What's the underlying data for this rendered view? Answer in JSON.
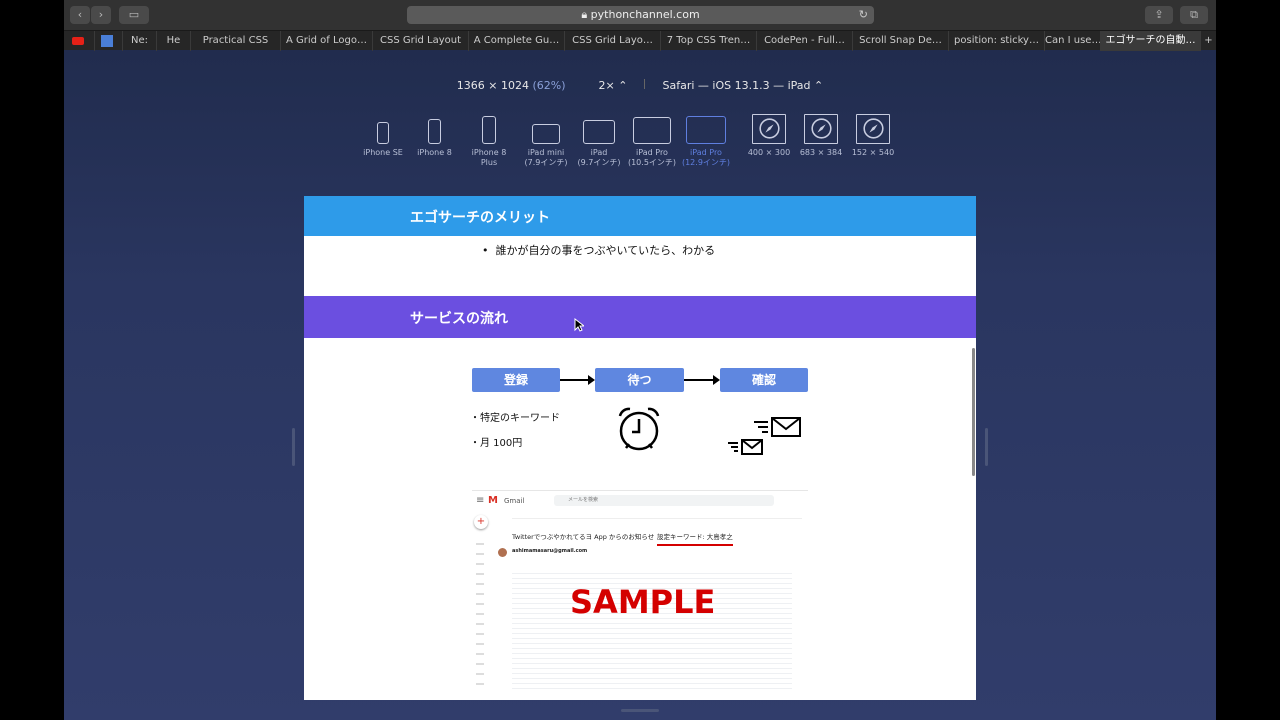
{
  "browser": {
    "url": "pythonchannel.com",
    "tabs": [
      {
        "label": "Ne:"
      },
      {
        "label": "He"
      },
      {
        "label": "Practical CSS"
      },
      {
        "label": "A Grid of Logo…"
      },
      {
        "label": "CSS Grid Layout"
      },
      {
        "label": "A Complete Gu…"
      },
      {
        "label": "CSS Grid Layo…"
      },
      {
        "label": "7 Top CSS Tren…"
      },
      {
        "label": "CodePen - Full…"
      },
      {
        "label": "Scroll Snap De…"
      },
      {
        "label": "position: sticky…"
      },
      {
        "label": "Can I use… S"
      },
      {
        "label": "エゴサーチの自動…"
      }
    ]
  },
  "rdm": {
    "size": "1366 × 1024",
    "scale_pct": "(62%)",
    "dpr": "2× ⌃",
    "ua": "Safari — iOS 13.1.3 — iPad ⌃",
    "devices": [
      {
        "label1": "iPhone SE",
        "label2": ""
      },
      {
        "label1": "iPhone 8",
        "label2": ""
      },
      {
        "label1": "iPhone 8",
        "label2": "Plus"
      },
      {
        "label1": "iPad mini",
        "label2": "(7.9インチ)"
      },
      {
        "label1": "iPad",
        "label2": "(9.7インチ)"
      },
      {
        "label1": "iPad Pro",
        "label2": "(10.5インチ)"
      },
      {
        "label1": "iPad Pro",
        "label2": "(12.9インチ)"
      },
      {
        "label1": "400 × 300",
        "label2": ""
      },
      {
        "label1": "683 × 384",
        "label2": ""
      },
      {
        "label1": "152 × 540",
        "label2": ""
      }
    ],
    "selected_device_index": 6,
    "accent": "#5f7fe0"
  },
  "page": {
    "merit_title": "エゴサーチのメリット",
    "merit_bullet": "誰かが自分の事をつぶやいていたら、わかる",
    "flow_title": "サービスの流れ",
    "steps": [
      "登録",
      "待つ",
      "確認"
    ],
    "notes": [
      "・特定のキーワード",
      "・月 100円"
    ],
    "gmail": {
      "brand": "Gmail",
      "search_placeholder": "メールを検索",
      "subject": "Twitterでつぶやかれてるヨ App からのお知らせ",
      "keyword": "設定キーワード: 大島孝之",
      "sender": "ashimamasaru@gmail.com",
      "sample": "SAMPLE"
    },
    "colors": {
      "blue_band": "#2e9be9",
      "purple_band": "#6b4fe0",
      "step": "#5f87e0",
      "sample": "#d40000"
    }
  }
}
